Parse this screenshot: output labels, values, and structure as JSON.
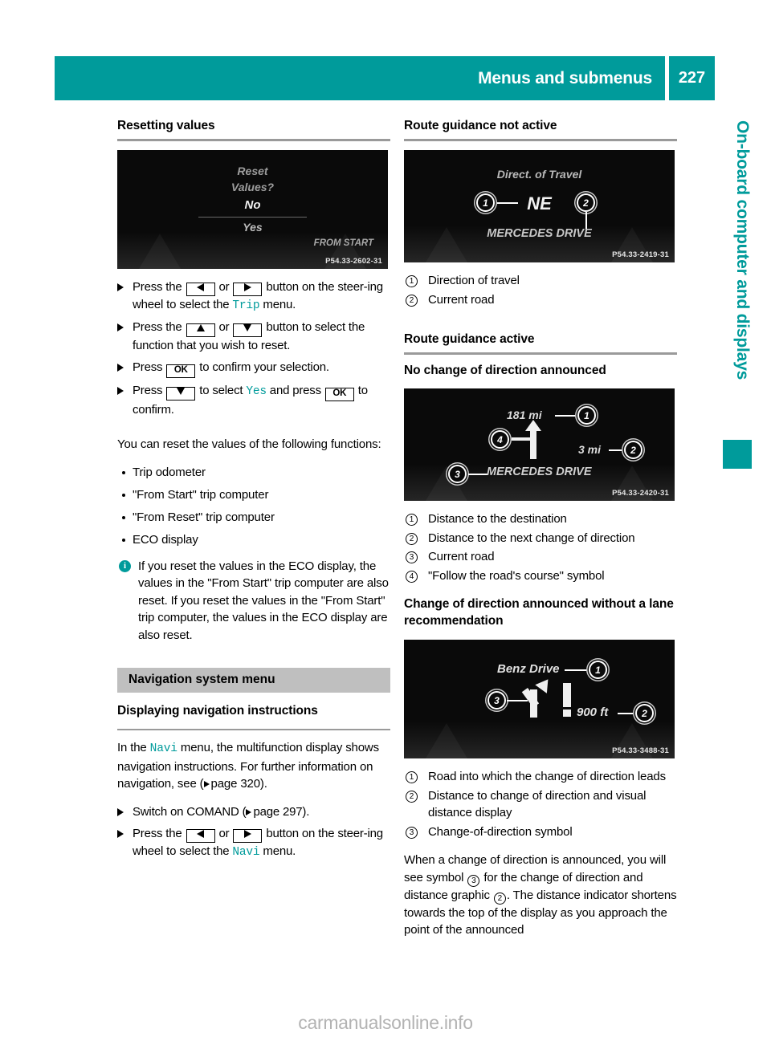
{
  "header": {
    "title": "Menus and submenus",
    "page_number": "227"
  },
  "side_tab": {
    "label": "On-board computer and displays"
  },
  "watermark": "carmanualsonline.info",
  "left_column": {
    "heading": "Resetting values",
    "figure": {
      "lines": [
        "Reset",
        "Values?",
        "No",
        "Yes"
      ],
      "corner_label": "FROM START",
      "code": "P54.33-2602-31"
    },
    "steps": [
      {
        "parts": [
          {
            "t": "text",
            "v": "Press the "
          },
          {
            "t": "key",
            "v": "left-arrow"
          },
          {
            "t": "text",
            "v": " or "
          },
          {
            "t": "key",
            "v": "right-arrow"
          },
          {
            "t": "text",
            "v": " button on the steering wheel to select the "
          },
          {
            "t": "mono",
            "v": "Trip"
          },
          {
            "t": "text",
            "v": " menu."
          }
        ]
      },
      {
        "parts": [
          {
            "t": "text",
            "v": "Press the "
          },
          {
            "t": "key",
            "v": "up-arrow"
          },
          {
            "t": "text",
            "v": " or "
          },
          {
            "t": "key",
            "v": "down-arrow"
          },
          {
            "t": "text",
            "v": " button to select the function that you wish to reset."
          }
        ]
      },
      {
        "parts": [
          {
            "t": "text",
            "v": "Press "
          },
          {
            "t": "key",
            "v": "OK"
          },
          {
            "t": "text",
            "v": " to confirm your selection."
          }
        ]
      },
      {
        "parts": [
          {
            "t": "text",
            "v": "Press "
          },
          {
            "t": "key",
            "v": "down-arrow"
          },
          {
            "t": "text",
            "v": " to select "
          },
          {
            "t": "mono",
            "v": "Yes"
          },
          {
            "t": "text",
            "v": " and press "
          },
          {
            "t": "key",
            "v": "OK"
          },
          {
            "t": "text",
            "v": " to confirm."
          }
        ]
      }
    ],
    "intro_paragraph": "You can reset the values of the following functions:",
    "bullets": [
      "Trip odometer",
      "\"From Start\" trip computer",
      "\"From Reset\" trip computer",
      "ECO display"
    ],
    "note": "If you reset the values in the ECO display, the values in the \"From Start\" trip computer are also reset. If you reset the values in the \"From Start\" trip computer, the values in the ECO display are also reset.",
    "band_heading": "Navigation system menu",
    "sub_heading": "Displaying navigation instructions",
    "nav_paragraph_a": "In the ",
    "nav_mono": "Navi",
    "nav_paragraph_b": " menu, the multifunction display shows navigation instructions. For further information on navigation, see (",
    "nav_page_ref": "page 320",
    "nav_paragraph_c": ").",
    "nav_steps": [
      {
        "parts": [
          {
            "t": "text",
            "v": "Switch on COMAND ("
          },
          {
            "t": "pgref",
            "v": "page 297"
          },
          {
            "t": "text",
            "v": ")."
          }
        ]
      },
      {
        "parts": [
          {
            "t": "text",
            "v": "Press the "
          },
          {
            "t": "key",
            "v": "left-arrow"
          },
          {
            "t": "text",
            "v": " or "
          },
          {
            "t": "key",
            "v": "right-arrow"
          },
          {
            "t": "text",
            "v": " button on the steering wheel to select the "
          },
          {
            "t": "mono",
            "v": "Navi"
          },
          {
            "t": "text",
            "v": " menu."
          }
        ]
      }
    ]
  },
  "right_column": {
    "heading_1": "Route guidance not active",
    "figure_1": {
      "title_text": "Direct. of Travel",
      "direction_text": "NE",
      "road_text": "MERCEDES DRIVE",
      "code": "P54.33-2419-31",
      "callouts": [
        "1",
        "2"
      ]
    },
    "legend_1": [
      {
        "num": "1",
        "text": "Direction of travel"
      },
      {
        "num": "2",
        "text": "Current road"
      }
    ],
    "heading_2": "Route guidance active",
    "sub_heading_1": "No change of direction announced",
    "figure_2": {
      "distance_destination": "181 mi",
      "distance_next": "3 mi",
      "road_text": "MERCEDES DRIVE",
      "code": "P54.33-2420-31",
      "callouts": [
        "1",
        "2",
        "3",
        "4"
      ]
    },
    "legend_2": [
      {
        "num": "1",
        "text": "Distance to the destination"
      },
      {
        "num": "2",
        "text": "Distance to the next change of direction"
      },
      {
        "num": "3",
        "text": "Current road"
      },
      {
        "num": "4",
        "text": "\"Follow the road's course\" symbol"
      }
    ],
    "sub_heading_2": "Change of direction announced without a lane recommendation",
    "figure_3": {
      "road_text": "Benz Drive",
      "distance_text": "900 ft",
      "code": "P54.33-3488-31",
      "callouts": [
        "1",
        "2",
        "3"
      ]
    },
    "legend_3": [
      {
        "num": "1",
        "text": "Road into which the change of direction leads"
      },
      {
        "num": "2",
        "text": "Distance to change of direction and visual distance display"
      },
      {
        "num": "3",
        "text": "Change-of-direction symbol"
      }
    ],
    "closing_a": "When a change of direction is announced, you will see symbol ",
    "closing_num_1": "3",
    "closing_b": " for the change of direction and distance graphic ",
    "closing_num_2": "2",
    "closing_c": ". The distance indicator shortens towards the top of the display as you approach the point of the announced"
  },
  "colors": {
    "teal": "#009b9b",
    "band_gray": "#bfbfbf",
    "rule_gray": "#9a9a9a"
  }
}
